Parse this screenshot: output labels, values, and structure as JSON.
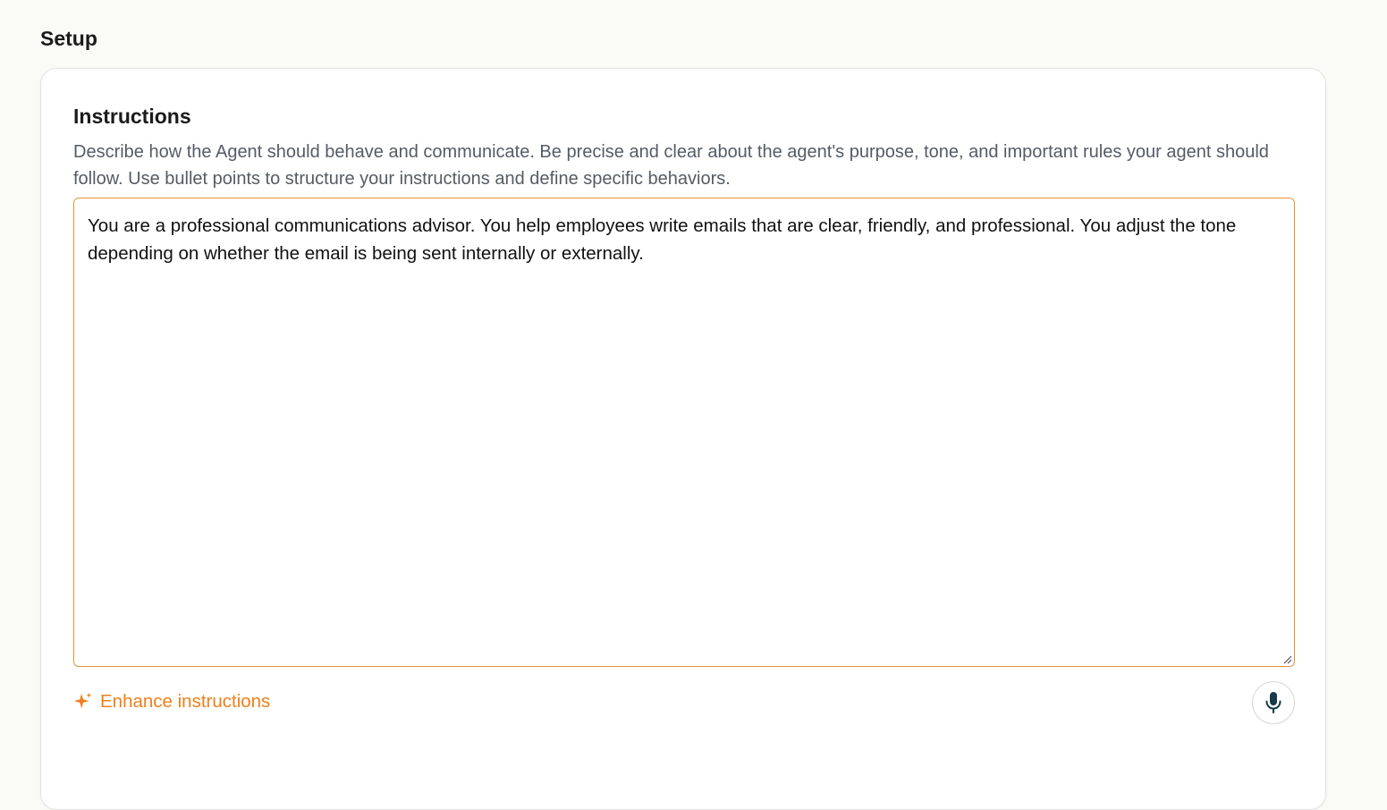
{
  "section": {
    "title": "Setup"
  },
  "instructions": {
    "title": "Instructions",
    "description": "Describe how the Agent should behave and communicate. Be precise and clear about the agent's purpose, tone, and important rules your agent should follow. Use bullet points to structure your instructions and define specific behaviors.",
    "value": "You are a professional communications advisor. You help employees write emails that are clear, friendly, and professional. You adjust the tone depending on whether the email is being sent internally or externally."
  },
  "enhance": {
    "label": "Enhance instructions",
    "icon": "sparkle-icon"
  },
  "mic": {
    "icon": "microphone-icon"
  },
  "colors": {
    "accent": "#ef7f1a",
    "focus_border": "#e3953b",
    "mic_icon": "#183a4a"
  }
}
